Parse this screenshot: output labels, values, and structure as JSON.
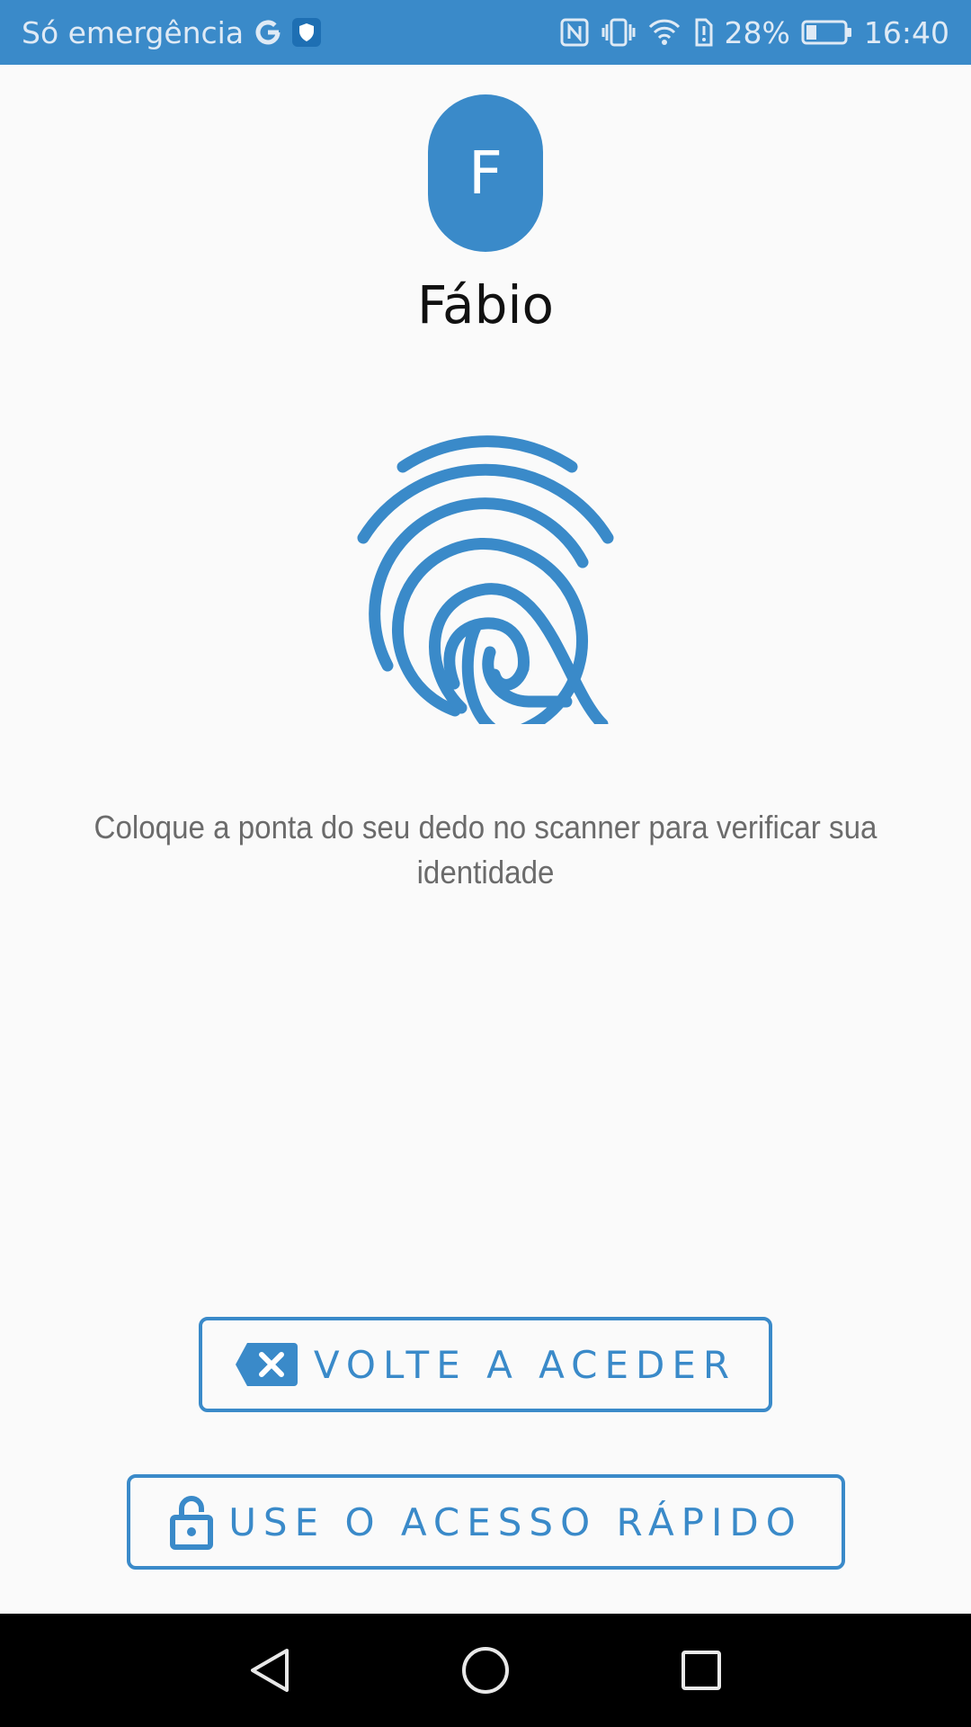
{
  "status_bar": {
    "carrier_text": "Só emergência",
    "g_icon": "google-g-icon",
    "shield_icon": "shield-icon",
    "nfc_icon": "nfc-icon",
    "vibrate_icon": "vibrate-icon",
    "wifi_icon": "wifi-icon",
    "battery_alert_icon": "battery-alert-icon",
    "battery_percent": "28%",
    "battery_level": 0.28,
    "time": "16:40"
  },
  "user": {
    "avatar_initial": "F",
    "name": "Fábio"
  },
  "fingerprint_icon": "fingerprint-icon",
  "instruction": "Coloque a ponta do seu dedo no scanner para verificar sua identidade",
  "buttons": {
    "voltar_label": "VOLTE A ACEDER",
    "voltar_icon": "backspace-x-icon",
    "rapido_label": "USE O ACESSO RÁPIDO",
    "rapido_icon": "unlock-icon"
  },
  "nav_bar": {
    "back_icon": "back-triangle-icon",
    "home_icon": "home-circle-icon",
    "recents_icon": "recents-square-icon"
  },
  "colors": {
    "accent": "#3a8ac9",
    "background": "#fafafa",
    "nav_bar": "#000000"
  }
}
